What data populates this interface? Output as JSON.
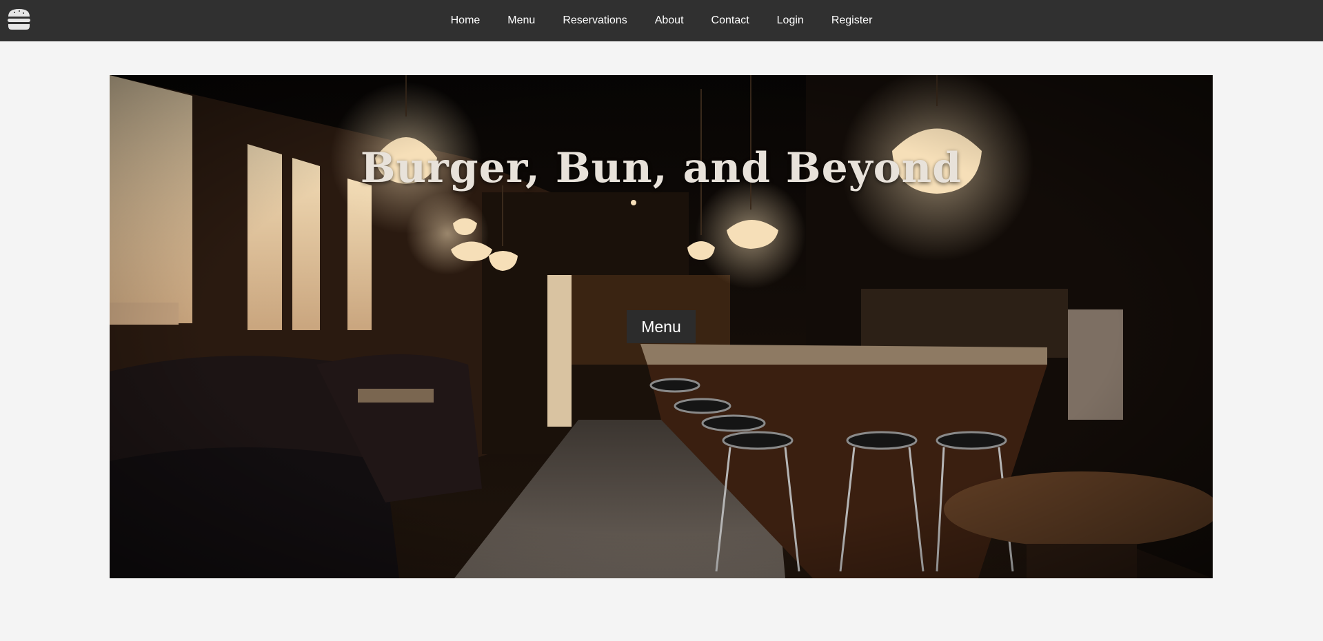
{
  "header": {
    "logo_icon": "burger-icon",
    "nav": [
      {
        "label": "Home"
      },
      {
        "label": "Menu"
      },
      {
        "label": "Reservations"
      },
      {
        "label": "About"
      },
      {
        "label": "Contact"
      },
      {
        "label": "Login"
      },
      {
        "label": "Register"
      }
    ]
  },
  "hero": {
    "title": "Burger, Bun, and Beyond",
    "button_label": "Menu",
    "image_subject": "restaurant-interior-photo"
  },
  "colors": {
    "header_bg": "#303030",
    "page_bg": "#f4f4f4",
    "button_bg": "#2c2c2c",
    "title_color": "#e8e2da",
    "lamp_glow": "#f6dfb8"
  }
}
